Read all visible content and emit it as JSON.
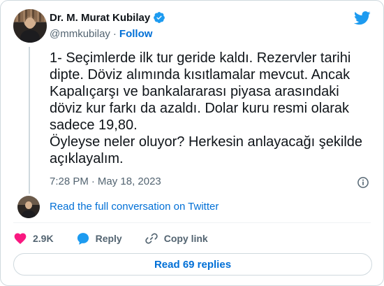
{
  "author": {
    "display_name": "Dr. M. Murat Kubilay",
    "handle": "@mmkubilay",
    "separator": "·",
    "follow_label": "Follow"
  },
  "tweet": {
    "text": "1- Seçimlerde ilk tur geride kaldı. Rezervler tarihi dipte. Döviz alımında kısıtlamalar mevcut. Ancak Kapalıçarşı ve bankalararası piyasa arasındaki döviz kur farkı da azaldı. Dolar kuru resmi olarak sadece 19,80.\nÖyleyse neler oluyor? Herkesin anlayacağı şekilde açıklayalım.",
    "time": "7:28 PM",
    "separator": "·",
    "date": "May 18, 2023"
  },
  "thread": {
    "read_full_label": "Read the full conversation on Twitter"
  },
  "actions": {
    "likes_count": "2.9K",
    "reply_label": "Reply",
    "copy_link_label": "Copy link"
  },
  "footer": {
    "read_replies_label": "Read 69 replies"
  },
  "colors": {
    "link": "#006fd6",
    "twitter_blue": "#1d9bf0",
    "heart": "#f91880",
    "muted": "#536471"
  },
  "icons": {
    "brand": "twitter-bird-icon",
    "verified": "verified-badge-icon",
    "info": "info-icon",
    "like": "heart-icon",
    "reply": "reply-bubble-icon",
    "copy": "link-icon"
  }
}
